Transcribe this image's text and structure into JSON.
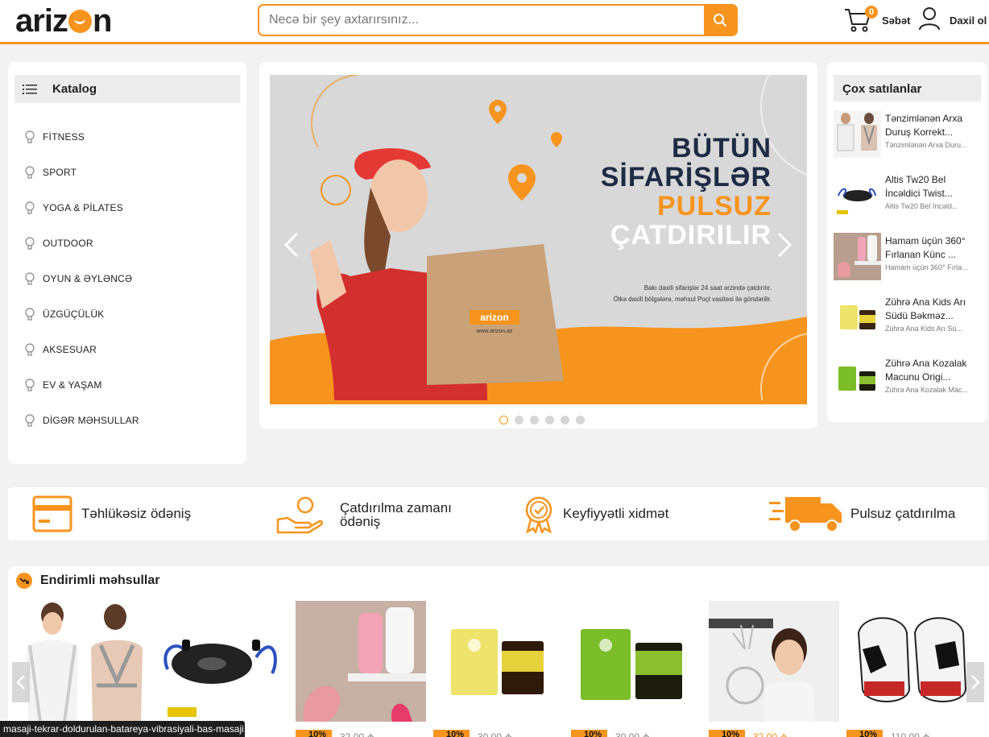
{
  "header": {
    "logo_text": "arizon",
    "search_placeholder": "Necə bir şey axtarırsınız...",
    "cart_count": "0",
    "cart_label": "Səbət",
    "login_label": "Daxil ol",
    "accent_color": "#f7941d"
  },
  "catalog": {
    "title": "Katalog",
    "items": [
      {
        "label": "FİTNESS"
      },
      {
        "label": "SPORT"
      },
      {
        "label": "YOGA & PİLATES"
      },
      {
        "label": "OUTDOOR"
      },
      {
        "label": "OYUN & ƏYLƏNCƏ"
      },
      {
        "label": "ÜZGÜÇÜLÜK"
      },
      {
        "label": "AKSESUAR"
      },
      {
        "label": "EV & YAŞAM"
      },
      {
        "label": "DİGƏR MƏHSULLAR"
      }
    ]
  },
  "banner": {
    "line1": "BÜTÜN",
    "line2": "SİFARİŞLƏR",
    "line3": "PULSUZ",
    "line4": "ÇATDIRILIR",
    "sub1": "Bakı daxili sifarişlər 24 saat ərzində çatdırılır.",
    "sub2": "Ölkə daxili bölgələrə, məhsul Poçt vasitəsi ilə göndərilir.",
    "bag_logo": "arizon",
    "bag_url": "www.arizon.az",
    "slide_count": 6,
    "active_slide": 1
  },
  "bestsellers": {
    "title": "Çox satılanlar",
    "items": [
      {
        "name": "Tənzimlənən Arxa Duruş Korrekt...",
        "sub": "Tənzimlənən Arxa Duru..."
      },
      {
        "name": "Altis Tw20 Bel İncəldici Twist...",
        "sub": "Altis Tw20 Bel İncəld..."
      },
      {
        "name": "Hamam üçün 360° Fırlanan Künc ...",
        "sub": "Hamam üçün 360° Fırla..."
      },
      {
        "name": "Zührə Ana Kids Arı Südü Bəkməz...",
        "sub": "Zührə Ana Kids Arı Sü..."
      },
      {
        "name": "Zührə Ana Kozalak Macunu Origi...",
        "sub": "Zührə Ana Kozalak Mac..."
      }
    ]
  },
  "features": [
    {
      "label": "Təhlükəsiz ödəniş"
    },
    {
      "label1": "Çatdırılma zamanı",
      "label2": "ödəniş"
    },
    {
      "label": "Keyfiyyətli xidmət"
    },
    {
      "label": "Pulsuz çatdırılma"
    }
  ],
  "discounted": {
    "title": "Endirimli məhsullar",
    "products": [
      {
        "badge": "",
        "old_price": ""
      },
      {
        "badge": "",
        "old_price": ""
      },
      {
        "badge": "10%",
        "old_price": "32.00 ₼"
      },
      {
        "badge": "10%",
        "old_price": "30.00 ₼"
      },
      {
        "badge": "10%",
        "old_price": "30.00 ₼"
      },
      {
        "badge": "10%",
        "old_price": "32.00 ₼"
      },
      {
        "badge": "10%",
        "old_price": "110.00 ₼"
      }
    ]
  },
  "status_url": "masaji-tekrar-doldurulan-batareya-vibrasiyali-bas-masaji"
}
